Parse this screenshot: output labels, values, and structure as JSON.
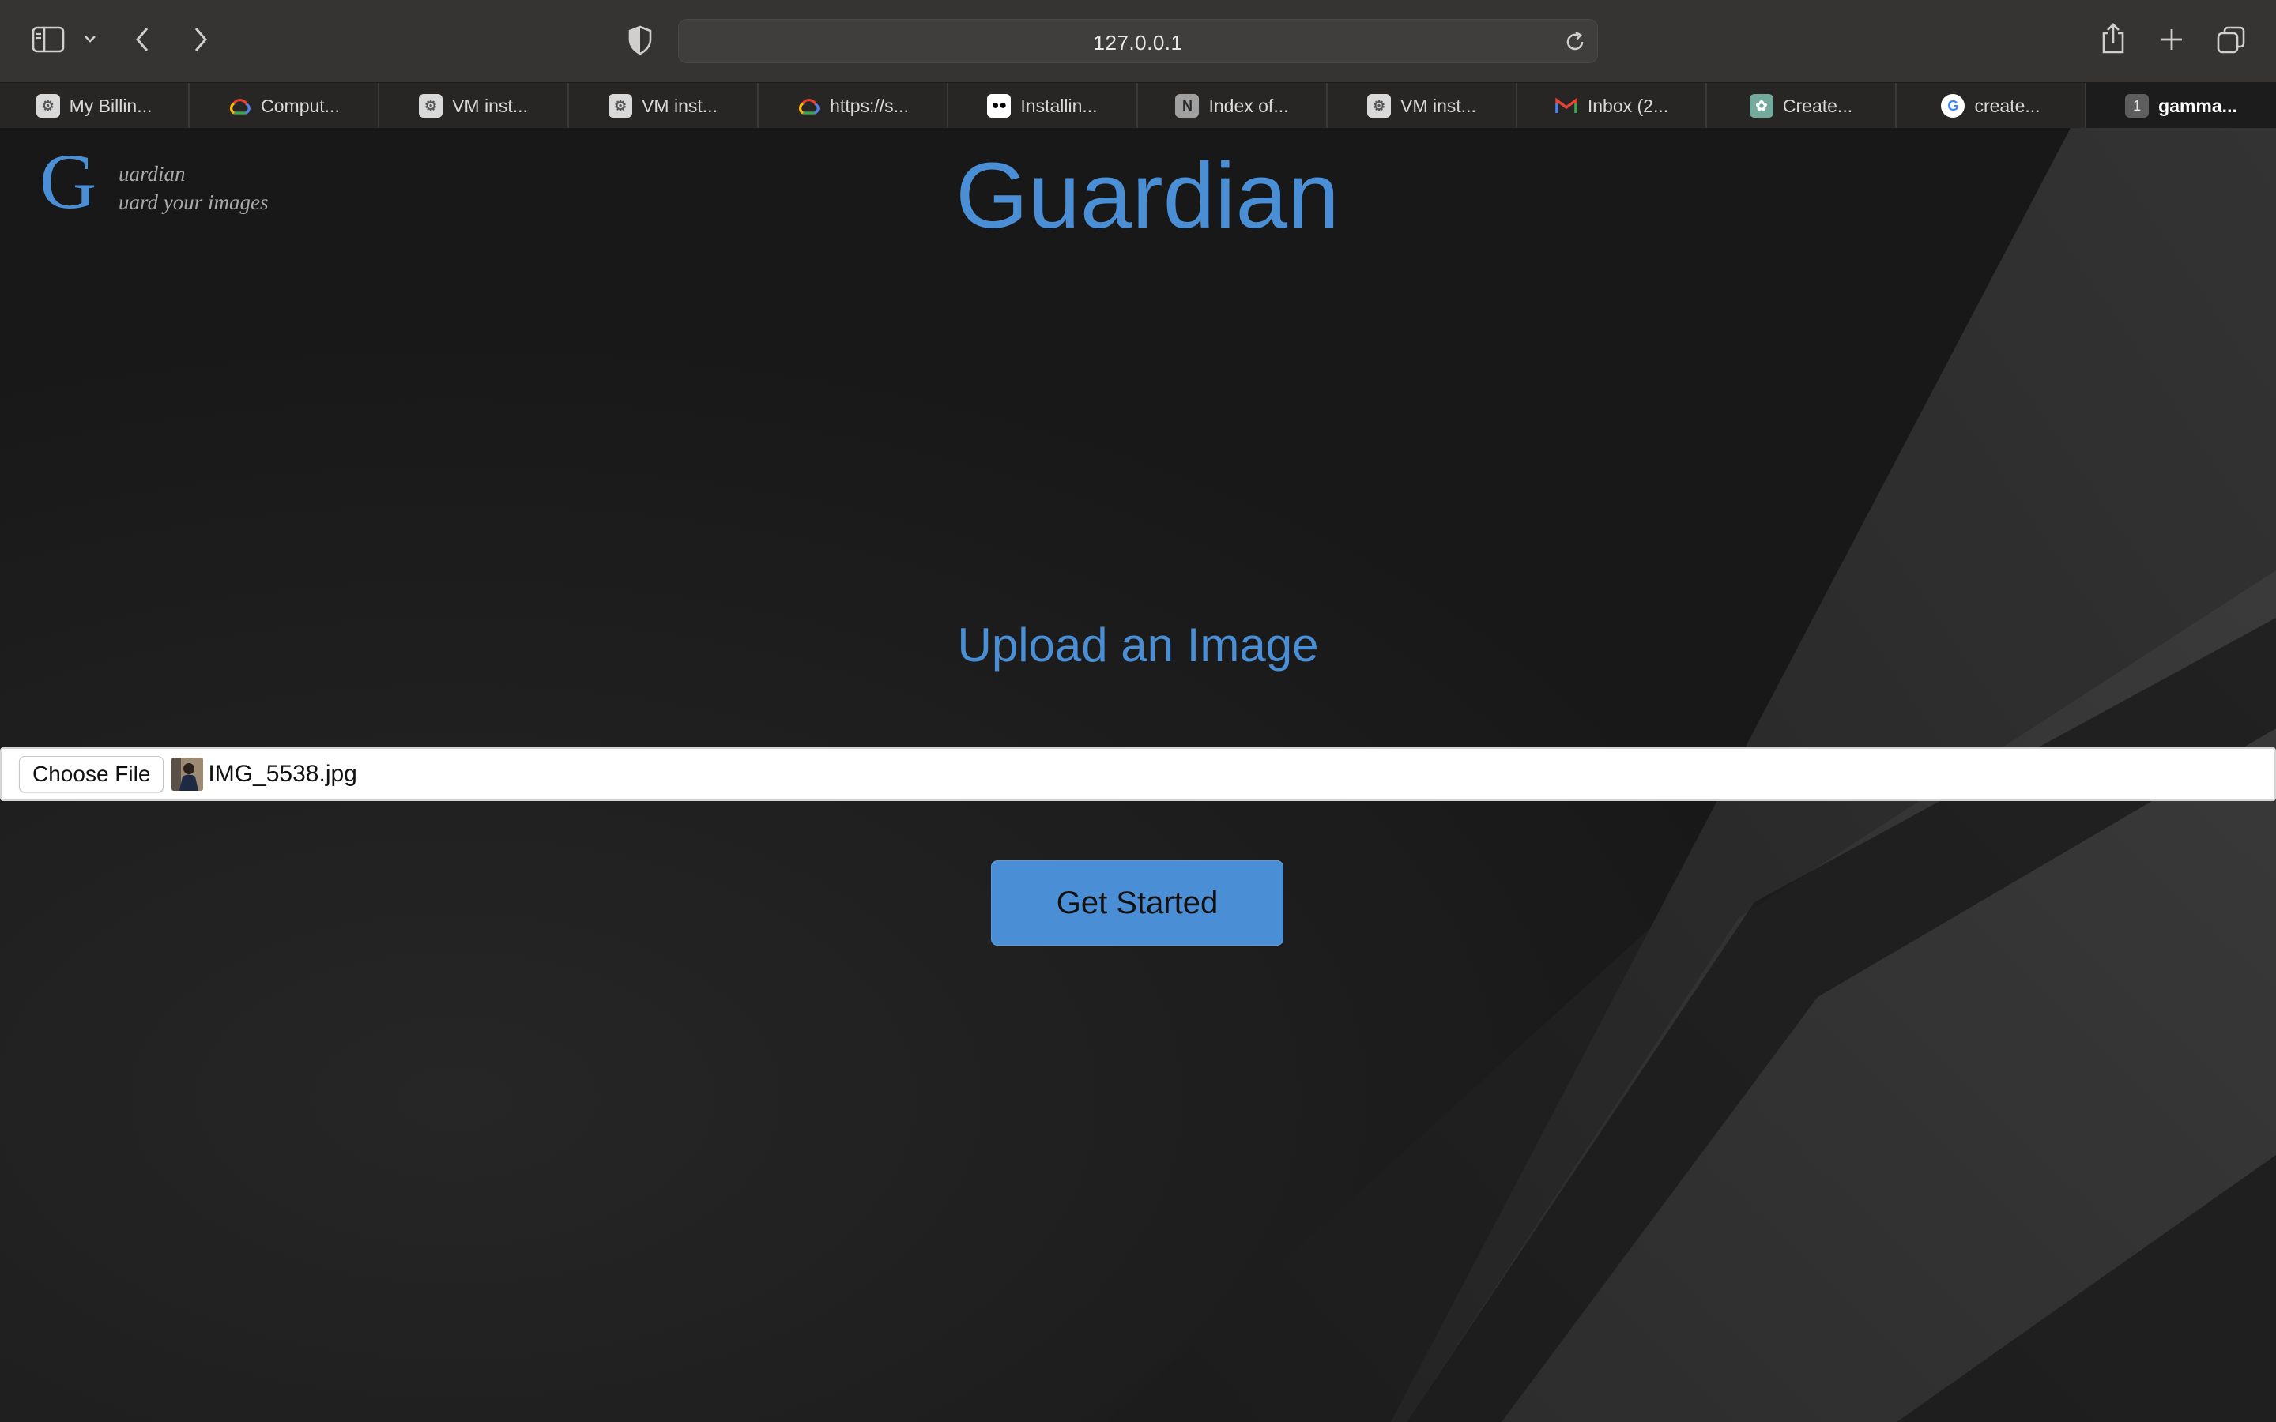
{
  "browser": {
    "url": "127.0.0.1",
    "tabs": [
      {
        "label": "My Billin...",
        "icon": "gear-icon"
      },
      {
        "label": "Comput...",
        "icon": "cloud-icon"
      },
      {
        "label": "VM inst...",
        "icon": "gear-icon"
      },
      {
        "label": "VM inst...",
        "icon": "gear-icon"
      },
      {
        "label": "https://s...",
        "icon": "cloud-icon"
      },
      {
        "label": "Installin...",
        "icon": "medium-icon"
      },
      {
        "label": "Index of...",
        "icon": "notion-icon"
      },
      {
        "label": "VM inst...",
        "icon": "gear-icon"
      },
      {
        "label": "Inbox (2...",
        "icon": "gmail-icon"
      },
      {
        "label": "Create...",
        "icon": "openai-icon"
      },
      {
        "label": "create...",
        "icon": "google-icon"
      },
      {
        "label": "gamma...",
        "icon": "number-icon",
        "badge": "1",
        "active": true
      }
    ]
  },
  "page": {
    "logo_letter": "G",
    "logo_line1": "uardian",
    "logo_line2": "uard your images",
    "title": "Guardian",
    "upload_heading": "Upload an Image",
    "choose_file_label": "Choose File",
    "file_name": "IMG_5538.jpg",
    "get_started_label": "Get Started"
  },
  "colors": {
    "accent": "#4a8fd6",
    "background": "#1a1a1a",
    "toolbar": "#363433"
  }
}
